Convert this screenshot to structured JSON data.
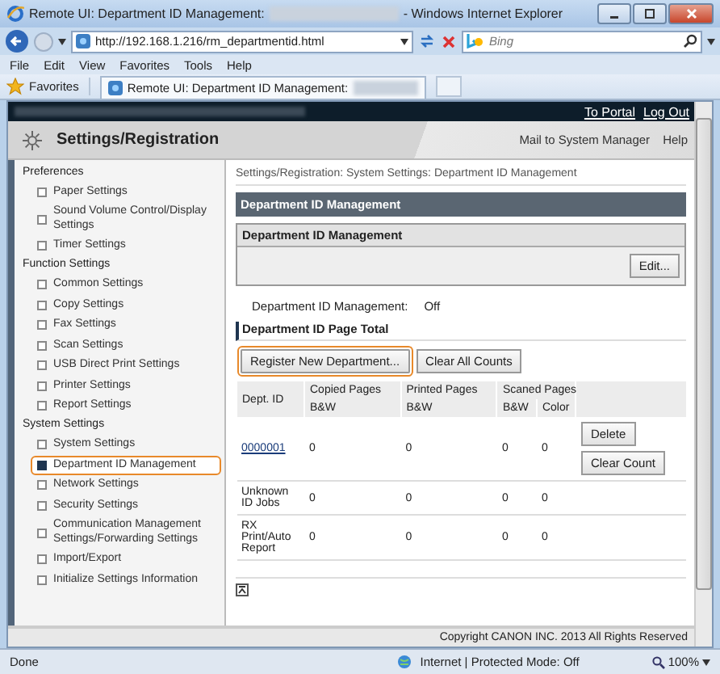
{
  "browser": {
    "title": "Remote UI: Department ID Management:",
    "title_suffix": "- Windows Internet Explorer",
    "url": "http://192.168.1.216/rm_departmentid.html",
    "search_placeholder": "Bing",
    "menu": [
      "File",
      "Edit",
      "View",
      "Favorites",
      "Tools",
      "Help"
    ],
    "favorites": "Favorites",
    "tab": "Remote UI: Department ID Management:"
  },
  "header": {
    "links": [
      "To Portal",
      "Log Out"
    ],
    "title": "Settings/Registration",
    "right_links": [
      "Mail to System Manager",
      "Help"
    ]
  },
  "sidebar": {
    "sections": [
      {
        "title": "Preferences",
        "items": [
          {
            "label": "Paper Settings",
            "selected": false
          },
          {
            "label": "Sound Volume Control/Display Settings",
            "selected": false
          },
          {
            "label": "Timer Settings",
            "selected": false
          }
        ]
      },
      {
        "title": "Function Settings",
        "items": [
          {
            "label": "Common Settings",
            "selected": false
          },
          {
            "label": "Copy Settings",
            "selected": false
          },
          {
            "label": "Fax Settings",
            "selected": false
          },
          {
            "label": "Scan Settings",
            "selected": false
          },
          {
            "label": "USB Direct Print Settings",
            "selected": false
          },
          {
            "label": "Printer Settings",
            "selected": false
          },
          {
            "label": "Report Settings",
            "selected": false
          }
        ]
      },
      {
        "title": "System Settings",
        "items": [
          {
            "label": "System Settings",
            "selected": false
          },
          {
            "label": "Department ID Management",
            "selected": true
          },
          {
            "label": "Network Settings",
            "selected": false
          },
          {
            "label": "Security Settings",
            "selected": false
          },
          {
            "label": "Communication Management Settings/Forwarding Settings",
            "selected": false
          },
          {
            "label": "Import/Export",
            "selected": false
          },
          {
            "label": "Initialize Settings Information",
            "selected": false
          }
        ]
      }
    ]
  },
  "content": {
    "breadcrumb": "Settings/Registration: System Settings: Department ID Management",
    "title": "Department ID Management",
    "panel": {
      "title": "Department ID Management",
      "button": "Edit..."
    },
    "setting": {
      "label": "Department ID Management:",
      "value": "Off"
    },
    "subheading": "Department ID Page Total",
    "buttons": [
      {
        "label": "Register New Department...",
        "highlighted": true
      },
      {
        "label": "Clear All Counts",
        "highlighted": false
      }
    ],
    "table": {
      "columns": [
        "Dept. ID",
        "Copied Pages",
        "Printed Pages",
        "Scaned Pages"
      ],
      "subcolumns": [
        "B&W",
        "B&W",
        "B&W",
        "Color"
      ],
      "rows": [
        {
          "kind": "link",
          "cells": [
            "0000001",
            "0",
            "0",
            "0",
            "0"
          ],
          "actions": [
            "Delete",
            "Clear Count"
          ]
        },
        {
          "kind": "text",
          "cells": [
            "Unknown ID Jobs",
            "0",
            "0",
            "0",
            "0"
          ]
        },
        {
          "kind": "text",
          "cells": [
            "RX Print/Auto Report",
            "0",
            "0",
            "0",
            "0"
          ]
        }
      ]
    }
  },
  "footer": "Copyright CANON INC. 2013 All Rights Reserved",
  "status": {
    "text": "Done",
    "zone": "Internet | Protected Mode: Off",
    "zoom": "100%"
  }
}
